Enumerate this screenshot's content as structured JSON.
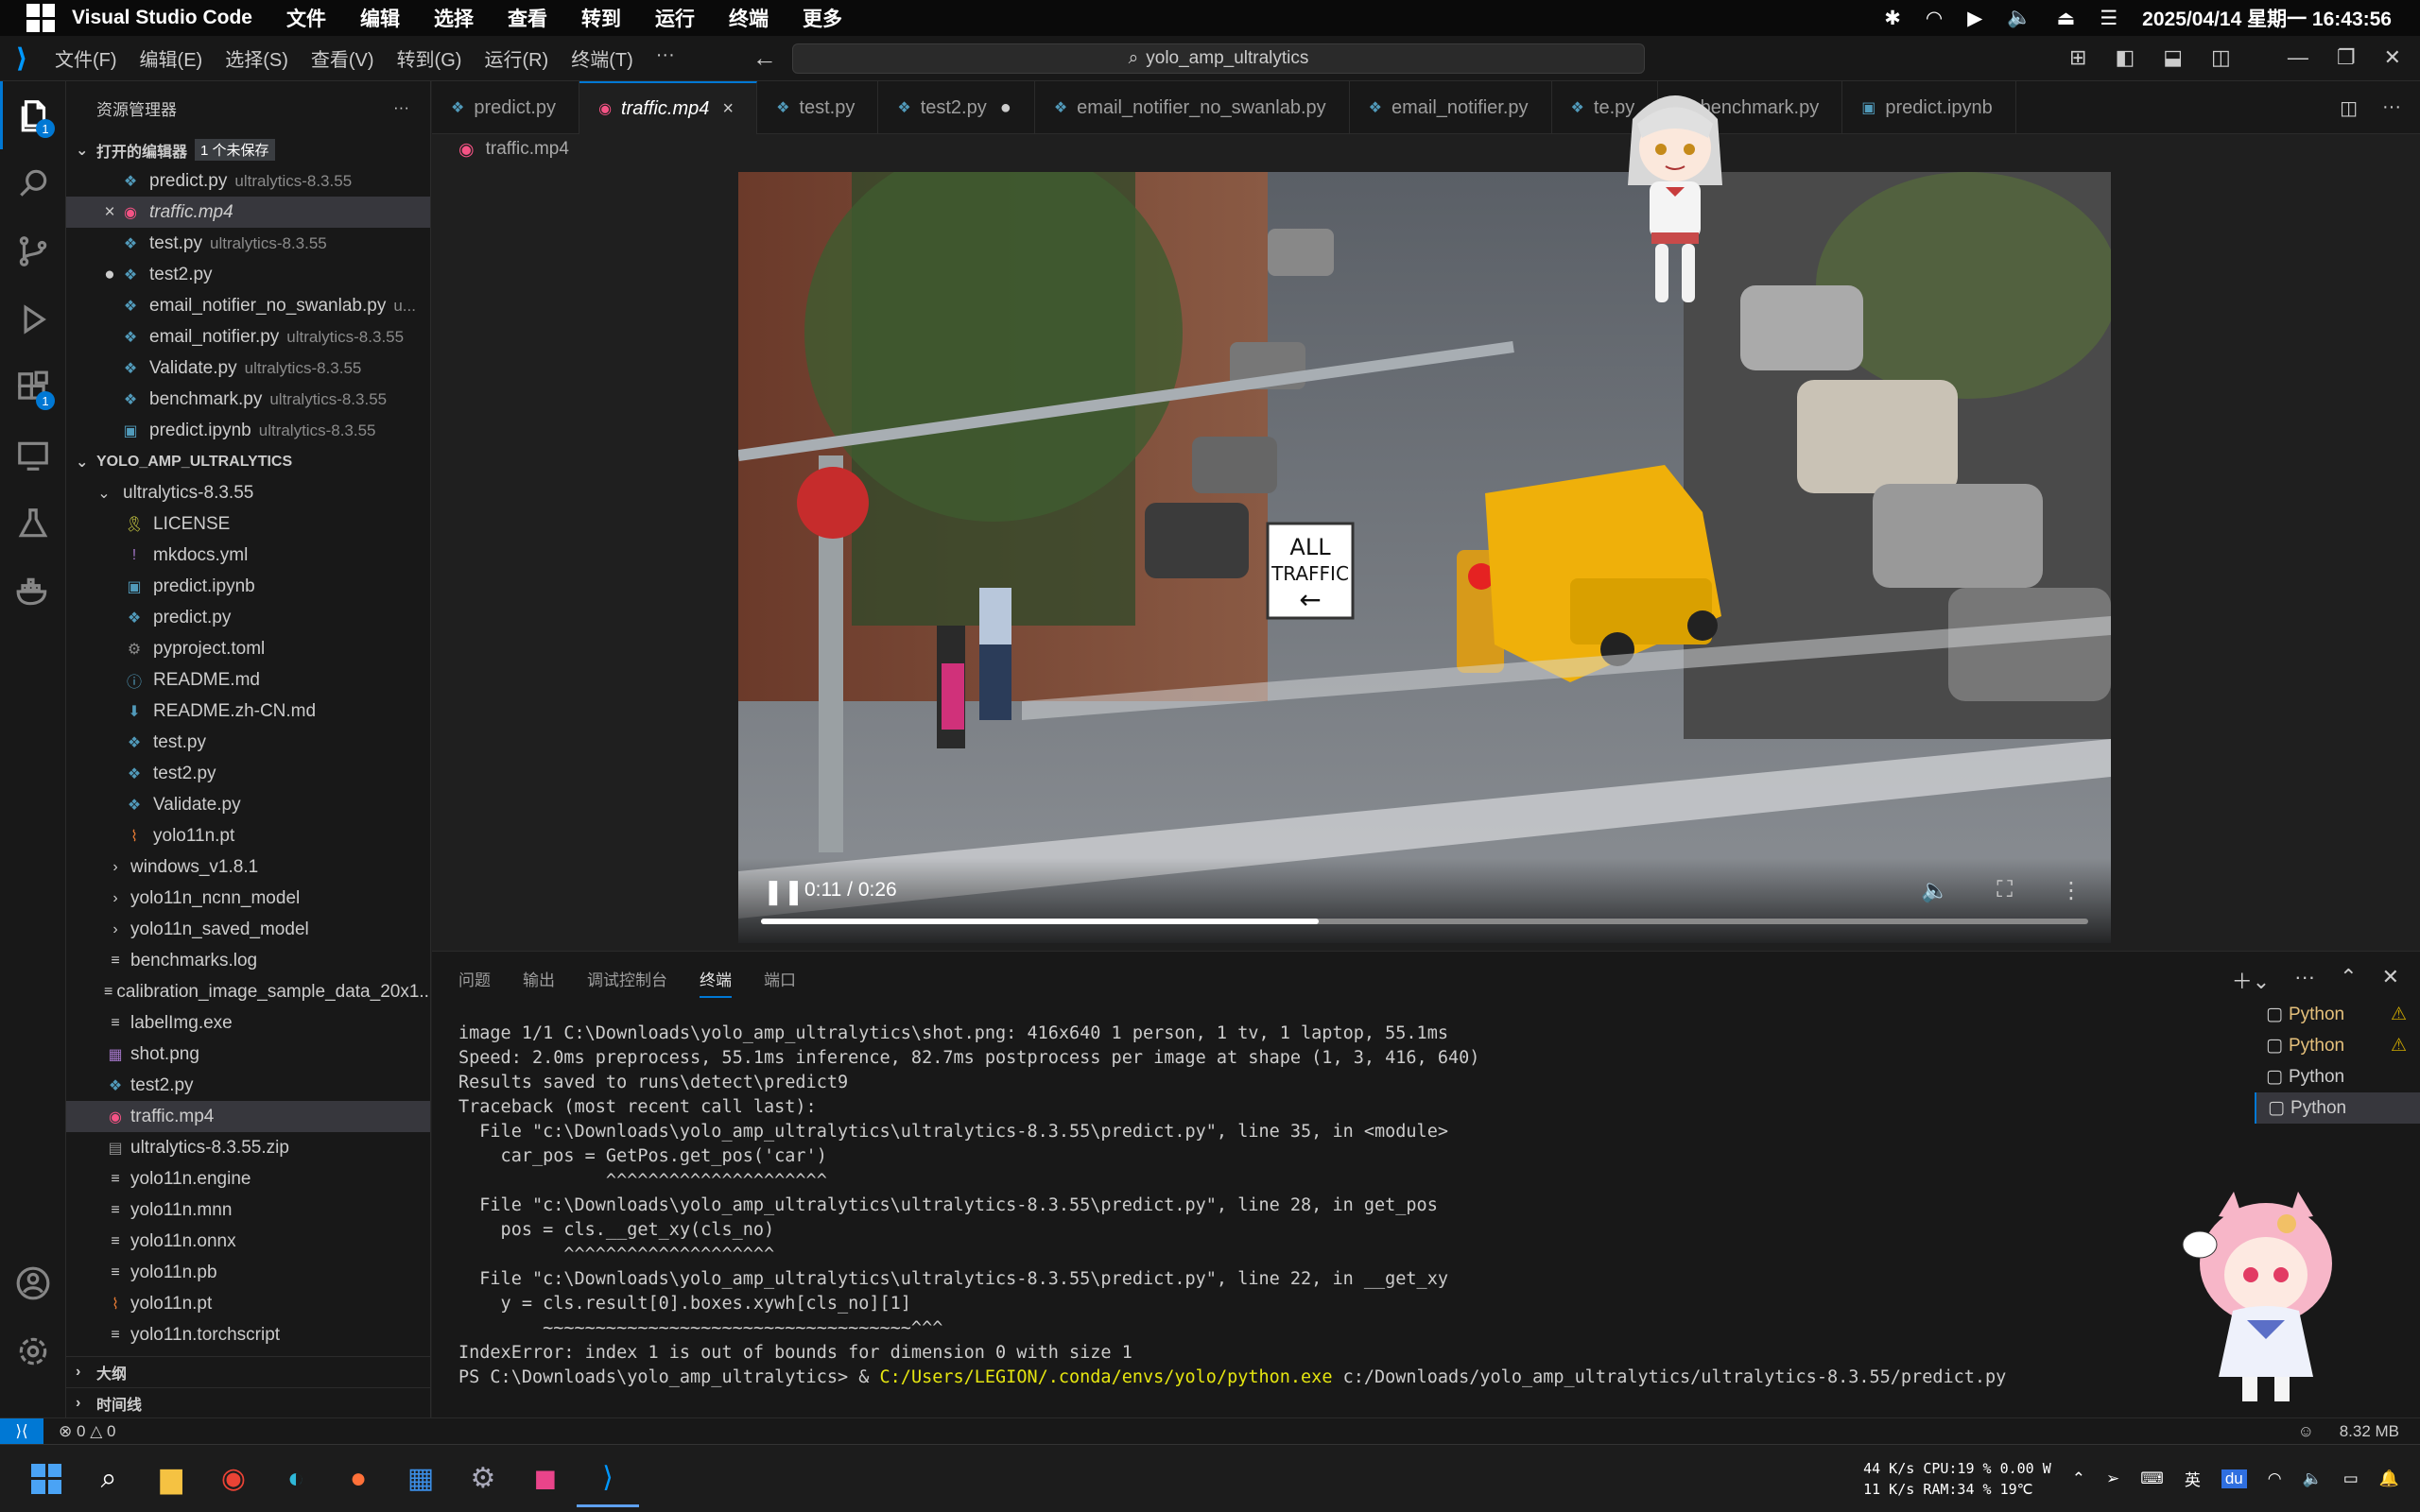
{
  "system_bar": {
    "app_name": "Visual Studio Code",
    "menus": [
      "文件",
      "编辑",
      "选择",
      "查看",
      "转到",
      "运行",
      "终端",
      "更多"
    ],
    "datetime": "2025/04/14 星期一 16:43:56"
  },
  "titlebar": {
    "menus": [
      "文件(F)",
      "编辑(E)",
      "选择(S)",
      "查看(V)",
      "转到(G)",
      "运行(R)",
      "终端(T)",
      "···"
    ],
    "search_text": "yolo_amp_ultralytics"
  },
  "activity_badges": {
    "explorer": "1",
    "extensions": "1"
  },
  "sidebar": {
    "title": "资源管理器",
    "more": "···",
    "open_editors_label": "打开的编辑器",
    "unsaved_badge": "1 个未保存",
    "open_editors": [
      {
        "name": "predict.py",
        "desc": "ultralytics-8.3.55",
        "icon": "python-icon",
        "mark": ""
      },
      {
        "name": "traffic.mp4",
        "desc": "",
        "icon": "video-icon",
        "mark": "×"
      },
      {
        "name": "test.py",
        "desc": "ultralytics-8.3.55",
        "icon": "python-icon",
        "mark": ""
      },
      {
        "name": "test2.py",
        "desc": "",
        "icon": "python-icon",
        "mark": "●"
      },
      {
        "name": "email_notifier_no_swanlab.py",
        "desc": "u...",
        "icon": "python-icon",
        "mark": ""
      },
      {
        "name": "email_notifier.py",
        "desc": "ultralytics-8.3.55",
        "icon": "python-icon",
        "mark": ""
      },
      {
        "name": "Validate.py",
        "desc": "ultralytics-8.3.55",
        "icon": "python-icon",
        "mark": ""
      },
      {
        "name": "benchmark.py",
        "desc": "ultralytics-8.3.55",
        "icon": "python-icon",
        "mark": ""
      },
      {
        "name": "predict.ipynb",
        "desc": "ultralytics-8.3.55",
        "icon": "notebook-icon",
        "mark": ""
      }
    ],
    "workspace_label": "YOLO_AMP_ULTRALYTICS",
    "folder": "ultralytics-8.3.55",
    "folder_files": [
      {
        "name": "LICENSE",
        "icon": "license-icon"
      },
      {
        "name": "mkdocs.yml",
        "icon": "yaml-icon"
      },
      {
        "name": "predict.ipynb",
        "icon": "notebook-icon"
      },
      {
        "name": "predict.py",
        "icon": "python-icon"
      },
      {
        "name": "pyproject.toml",
        "icon": "gear-icon"
      },
      {
        "name": "README.md",
        "icon": "info-icon"
      },
      {
        "name": "README.zh-CN.md",
        "icon": "markdown-icon"
      },
      {
        "name": "test.py",
        "icon": "python-icon"
      },
      {
        "name": "test2.py",
        "icon": "python-icon"
      },
      {
        "name": "Validate.py",
        "icon": "python-icon"
      },
      {
        "name": "yolo11n.pt",
        "icon": "rss-icon"
      }
    ],
    "root_items": [
      {
        "name": "windows_v1.8.1",
        "icon": "folder-icon"
      },
      {
        "name": "yolo11n_ncnn_model",
        "icon": "folder-icon"
      },
      {
        "name": "yolo11n_saved_model",
        "icon": "folder-icon"
      },
      {
        "name": "benchmarks.log",
        "icon": "text-icon"
      },
      {
        "name": "calibration_image_sample_data_20x1...",
        "icon": "text-icon"
      },
      {
        "name": "labelImg.exe",
        "icon": "text-icon"
      },
      {
        "name": "shot.png",
        "icon": "image-icon"
      },
      {
        "name": "test2.py",
        "icon": "python-icon"
      },
      {
        "name": "traffic.mp4",
        "icon": "video-icon"
      },
      {
        "name": "ultralytics-8.3.55.zip",
        "icon": "zip-icon"
      },
      {
        "name": "yolo11n.engine",
        "icon": "text-icon"
      },
      {
        "name": "yolo11n.mnn",
        "icon": "text-icon"
      },
      {
        "name": "yolo11n.onnx",
        "icon": "text-icon"
      },
      {
        "name": "yolo11n.pb",
        "icon": "text-icon"
      },
      {
        "name": "yolo11n.pt",
        "icon": "rss-icon"
      },
      {
        "name": "yolo11n.torchscript",
        "icon": "text-icon"
      }
    ],
    "outline_label": "大纲",
    "timeline_label": "时间线"
  },
  "tabs": [
    {
      "label": "predict.py",
      "active": false,
      "end": ""
    },
    {
      "label": "traffic.mp4",
      "active": true,
      "end": "×"
    },
    {
      "label": "test.py",
      "active": false,
      "end": ""
    },
    {
      "label": "test2.py",
      "active": false,
      "end": "●"
    },
    {
      "label": "email_notifier_no_swanlab.py",
      "active": false,
      "end": ""
    },
    {
      "label": "email_notifier.py",
      "active": false,
      "end": ""
    },
    {
      "label": "te.py",
      "active": false,
      "end": ""
    },
    {
      "label": "benchmark.py",
      "active": false,
      "end": ""
    },
    {
      "label": "predict.ipynb",
      "active": false,
      "end": ""
    }
  ],
  "breadcrumb": "traffic.mp4",
  "video": {
    "time": "0:11 / 0:26",
    "progress": 0.42,
    "sign_text_1": "ALL",
    "sign_text_2": "TRAFFIC"
  },
  "panel": {
    "tabs": [
      "问题",
      "输出",
      "调试控制台",
      "终端",
      "端口"
    ],
    "active_tab": "终端",
    "terminal_lines": [
      "image 1/1 C:\\Downloads\\yolo_amp_ultralytics\\shot.png: 416x640 1 person, 1 tv, 1 laptop, 55.1ms",
      "Speed: 2.0ms preprocess, 55.1ms inference, 82.7ms postprocess per image at shape (1, 3, 416, 640)",
      "Results saved to runs\\detect\\predict9",
      "Traceback (most recent call last):",
      "  File \"c:\\Downloads\\yolo_amp_ultralytics\\ultralytics-8.3.55\\predict.py\", line 35, in <module>",
      "    car_pos = GetPos.get_pos('car')",
      "              ^^^^^^^^^^^^^^^^^^^^^",
      "  File \"c:\\Downloads\\yolo_amp_ultralytics\\ultralytics-8.3.55\\predict.py\", line 28, in get_pos",
      "    pos = cls.__get_xy(cls_no)",
      "          ^^^^^^^^^^^^^^^^^^^^",
      "  File \"c:\\Downloads\\yolo_amp_ultralytics\\ultralytics-8.3.55\\predict.py\", line 22, in __get_xy",
      "    y = cls.result[0].boxes.xywh[cls_no][1]",
      "        ~~~~~~~~~~~~~~~~~~~~~~~~~~~~~~~~~~~^^^",
      "IndexError: index 1 is out of bounds for dimension 0 with size 1"
    ],
    "prompt_prefix": "PS C:\\Downloads\\yolo_amp_ultralytics> & ",
    "prompt_exe": "C:/Users/LEGION/.conda/envs/yolo/python.exe",
    "prompt_arg": " c:/Downloads/yolo_amp_ultralytics/ultralytics-8.3.55/predict.py",
    "terminals": [
      {
        "label": "Python",
        "warn": "⚠"
      },
      {
        "label": "Python",
        "warn": "⚠"
      },
      {
        "label": "Python",
        "warn": ""
      },
      {
        "label": "Python",
        "warn": ""
      }
    ]
  },
  "status": {
    "errors": "0",
    "warnings": "0",
    "memory": "8.32 MB"
  },
  "taskbar": {
    "net_up": "44 K/s",
    "net_down": "11 K/s",
    "cpu": "CPU:19 %",
    "ram": "RAM:34 %",
    "power": "0.00 W",
    "temp": "19℃"
  }
}
